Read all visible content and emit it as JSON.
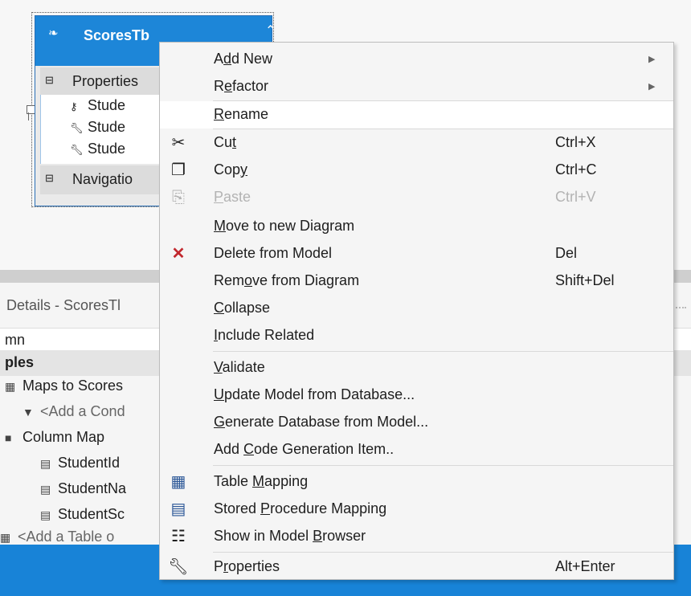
{
  "entity": {
    "title": "ScoresTb",
    "properties_label": "Properties",
    "navigation_label": "Navigatio",
    "properties": [
      "Stude",
      "Stude",
      "Stude"
    ]
  },
  "details": {
    "title": "Details - ScoresTl",
    "column_header": "mn",
    "group": "ples",
    "rows": [
      {
        "text": "Maps to Scores"
      },
      {
        "text": "<Add a Cond"
      },
      {
        "text": "Column Map"
      },
      {
        "text": "StudentId"
      },
      {
        "text": "StudentNa"
      },
      {
        "text": "StudentSc"
      },
      {
        "text": "<Add a Table o"
      }
    ]
  },
  "menu": {
    "items": [
      {
        "label_pre": "A",
        "label_ul": "d",
        "label_post": "d New",
        "submenu": true
      },
      {
        "label_pre": "R",
        "label_ul": "e",
        "label_post": "factor",
        "submenu": true
      },
      {
        "label_pre": "",
        "label_ul": "R",
        "label_post": "ename",
        "highlighted": true
      },
      {
        "label_pre": "Cu",
        "label_ul": "t",
        "label_post": "",
        "shortcut": "Ctrl+X",
        "icon": "scissors-icon"
      },
      {
        "label_pre": "Cop",
        "label_ul": "y",
        "label_post": "",
        "shortcut": "Ctrl+C",
        "icon": "copy-icon"
      },
      {
        "label_pre": "",
        "label_ul": "P",
        "label_post": "aste",
        "shortcut": "Ctrl+V",
        "icon": "paste-icon",
        "disabled": true
      },
      {
        "label_pre": "",
        "label_ul": "M",
        "label_post": "ove to new Diagram"
      },
      {
        "label_pre": "Delete from Model",
        "label_ul": "",
        "label_post": "",
        "shortcut": "Del",
        "icon": "delete-icon"
      },
      {
        "label_pre": "Rem",
        "label_ul": "o",
        "label_post": "ve from Diagram",
        "shortcut": "Shift+Del"
      },
      {
        "label_pre": "",
        "label_ul": "C",
        "label_post": "ollapse"
      },
      {
        "label_pre": "",
        "label_ul": "I",
        "label_post": "nclude Related"
      },
      {
        "label_pre": "",
        "label_ul": "V",
        "label_post": "alidate"
      },
      {
        "label_pre": "",
        "label_ul": "U",
        "label_post": "pdate Model from Database..."
      },
      {
        "label_pre": "",
        "label_ul": "G",
        "label_post": "enerate Database from Model..."
      },
      {
        "label_pre": "Add ",
        "label_ul": "C",
        "label_post": "ode Generation Item.."
      },
      {
        "label_pre": "Table ",
        "label_ul": "M",
        "label_post": "apping",
        "icon": "table-mapping-icon"
      },
      {
        "label_pre": "Stored ",
        "label_ul": "P",
        "label_post": "rocedure Mapping",
        "icon": "stored-procedure-icon"
      },
      {
        "label_pre": "Show in Model ",
        "label_ul": "B",
        "label_post": "rowser",
        "icon": "model-browser-icon"
      },
      {
        "label_pre": "P",
        "label_ul": "r",
        "label_post": "operties",
        "shortcut": "Alt+Enter",
        "icon": "wrench-icon"
      }
    ]
  },
  "colors": {
    "accent": "#1d86d8",
    "statusbar": "#1883d7",
    "delete": "#c1272d"
  }
}
